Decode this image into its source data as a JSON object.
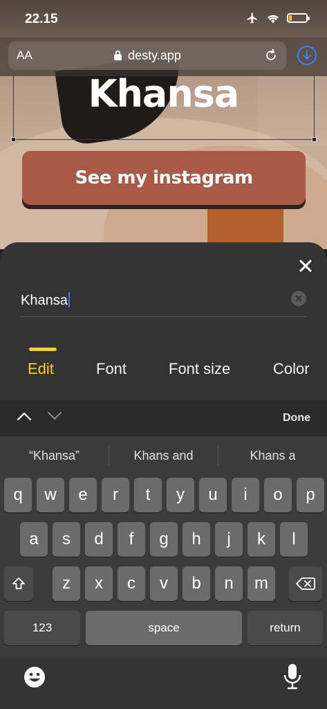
{
  "status": {
    "time": "22.15",
    "battery_level": 0.15
  },
  "browser": {
    "text_size_label": "AA",
    "url": "desty.app"
  },
  "web": {
    "name_title": "Khansa",
    "cta_label": "See my instagram"
  },
  "editor": {
    "text_value": "Khansa",
    "tabs": [
      "Edit",
      "Font",
      "Font size",
      "Color"
    ],
    "active_tab": "Edit"
  },
  "keyboard": {
    "done_label": "Done",
    "suggestions": [
      "“Khansa”",
      "Khans and",
      "Khans a"
    ],
    "row1": [
      "q",
      "w",
      "e",
      "r",
      "t",
      "y",
      "u",
      "i",
      "o",
      "p"
    ],
    "row2": [
      "a",
      "s",
      "d",
      "f",
      "g",
      "h",
      "j",
      "k",
      "l"
    ],
    "row3": [
      "z",
      "x",
      "c",
      "v",
      "b",
      "n",
      "m"
    ],
    "numbers_label": "123",
    "space_label": "space",
    "return_label": "return"
  },
  "colors": {
    "accent": "#f4d41c",
    "cta": "#a85a47",
    "sheet": "#333333",
    "link_blue": "#3b82f6"
  }
}
